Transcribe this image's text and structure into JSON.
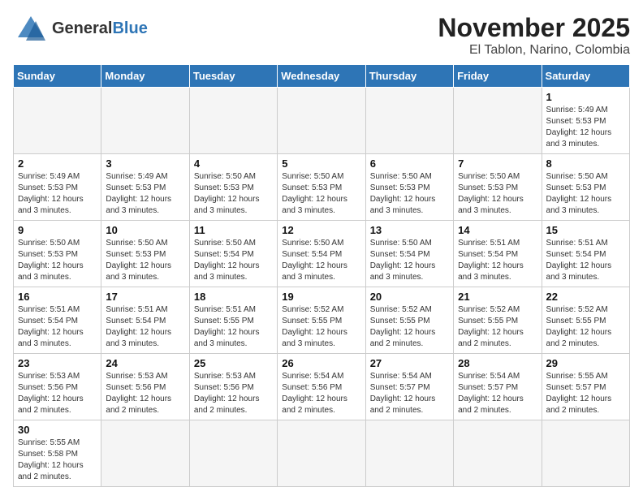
{
  "header": {
    "logo_general": "General",
    "logo_blue": "Blue",
    "month_title": "November 2025",
    "location": "El Tablon, Narino, Colombia"
  },
  "weekdays": [
    "Sunday",
    "Monday",
    "Tuesday",
    "Wednesday",
    "Thursday",
    "Friday",
    "Saturday"
  ],
  "weeks": [
    [
      {
        "day": "",
        "info": "",
        "empty": true
      },
      {
        "day": "",
        "info": "",
        "empty": true
      },
      {
        "day": "",
        "info": "",
        "empty": true
      },
      {
        "day": "",
        "info": "",
        "empty": true
      },
      {
        "day": "",
        "info": "",
        "empty": true
      },
      {
        "day": "",
        "info": "",
        "empty": true
      },
      {
        "day": "1",
        "info": "Sunrise: 5:49 AM\nSunset: 5:53 PM\nDaylight: 12 hours and 3 minutes."
      }
    ],
    [
      {
        "day": "2",
        "info": "Sunrise: 5:49 AM\nSunset: 5:53 PM\nDaylight: 12 hours and 3 minutes."
      },
      {
        "day": "3",
        "info": "Sunrise: 5:49 AM\nSunset: 5:53 PM\nDaylight: 12 hours and 3 minutes."
      },
      {
        "day": "4",
        "info": "Sunrise: 5:50 AM\nSunset: 5:53 PM\nDaylight: 12 hours and 3 minutes."
      },
      {
        "day": "5",
        "info": "Sunrise: 5:50 AM\nSunset: 5:53 PM\nDaylight: 12 hours and 3 minutes."
      },
      {
        "day": "6",
        "info": "Sunrise: 5:50 AM\nSunset: 5:53 PM\nDaylight: 12 hours and 3 minutes."
      },
      {
        "day": "7",
        "info": "Sunrise: 5:50 AM\nSunset: 5:53 PM\nDaylight: 12 hours and 3 minutes."
      },
      {
        "day": "8",
        "info": "Sunrise: 5:50 AM\nSunset: 5:53 PM\nDaylight: 12 hours and 3 minutes."
      }
    ],
    [
      {
        "day": "9",
        "info": "Sunrise: 5:50 AM\nSunset: 5:53 PM\nDaylight: 12 hours and 3 minutes."
      },
      {
        "day": "10",
        "info": "Sunrise: 5:50 AM\nSunset: 5:53 PM\nDaylight: 12 hours and 3 minutes."
      },
      {
        "day": "11",
        "info": "Sunrise: 5:50 AM\nSunset: 5:54 PM\nDaylight: 12 hours and 3 minutes."
      },
      {
        "day": "12",
        "info": "Sunrise: 5:50 AM\nSunset: 5:54 PM\nDaylight: 12 hours and 3 minutes."
      },
      {
        "day": "13",
        "info": "Sunrise: 5:50 AM\nSunset: 5:54 PM\nDaylight: 12 hours and 3 minutes."
      },
      {
        "day": "14",
        "info": "Sunrise: 5:51 AM\nSunset: 5:54 PM\nDaylight: 12 hours and 3 minutes."
      },
      {
        "day": "15",
        "info": "Sunrise: 5:51 AM\nSunset: 5:54 PM\nDaylight: 12 hours and 3 minutes."
      }
    ],
    [
      {
        "day": "16",
        "info": "Sunrise: 5:51 AM\nSunset: 5:54 PM\nDaylight: 12 hours and 3 minutes."
      },
      {
        "day": "17",
        "info": "Sunrise: 5:51 AM\nSunset: 5:54 PM\nDaylight: 12 hours and 3 minutes."
      },
      {
        "day": "18",
        "info": "Sunrise: 5:51 AM\nSunset: 5:55 PM\nDaylight: 12 hours and 3 minutes."
      },
      {
        "day": "19",
        "info": "Sunrise: 5:52 AM\nSunset: 5:55 PM\nDaylight: 12 hours and 3 minutes."
      },
      {
        "day": "20",
        "info": "Sunrise: 5:52 AM\nSunset: 5:55 PM\nDaylight: 12 hours and 2 minutes."
      },
      {
        "day": "21",
        "info": "Sunrise: 5:52 AM\nSunset: 5:55 PM\nDaylight: 12 hours and 2 minutes."
      },
      {
        "day": "22",
        "info": "Sunrise: 5:52 AM\nSunset: 5:55 PM\nDaylight: 12 hours and 2 minutes."
      }
    ],
    [
      {
        "day": "23",
        "info": "Sunrise: 5:53 AM\nSunset: 5:56 PM\nDaylight: 12 hours and 2 minutes."
      },
      {
        "day": "24",
        "info": "Sunrise: 5:53 AM\nSunset: 5:56 PM\nDaylight: 12 hours and 2 minutes."
      },
      {
        "day": "25",
        "info": "Sunrise: 5:53 AM\nSunset: 5:56 PM\nDaylight: 12 hours and 2 minutes."
      },
      {
        "day": "26",
        "info": "Sunrise: 5:54 AM\nSunset: 5:56 PM\nDaylight: 12 hours and 2 minutes."
      },
      {
        "day": "27",
        "info": "Sunrise: 5:54 AM\nSunset: 5:57 PM\nDaylight: 12 hours and 2 minutes."
      },
      {
        "day": "28",
        "info": "Sunrise: 5:54 AM\nSunset: 5:57 PM\nDaylight: 12 hours and 2 minutes."
      },
      {
        "day": "29",
        "info": "Sunrise: 5:55 AM\nSunset: 5:57 PM\nDaylight: 12 hours and 2 minutes."
      }
    ],
    [
      {
        "day": "30",
        "info": "Sunrise: 5:55 AM\nSunset: 5:58 PM\nDaylight: 12 hours and 2 minutes."
      },
      {
        "day": "",
        "info": "",
        "empty": true
      },
      {
        "day": "",
        "info": "",
        "empty": true
      },
      {
        "day": "",
        "info": "",
        "empty": true
      },
      {
        "day": "",
        "info": "",
        "empty": true
      },
      {
        "day": "",
        "info": "",
        "empty": true
      },
      {
        "day": "",
        "info": "",
        "empty": true
      }
    ]
  ]
}
